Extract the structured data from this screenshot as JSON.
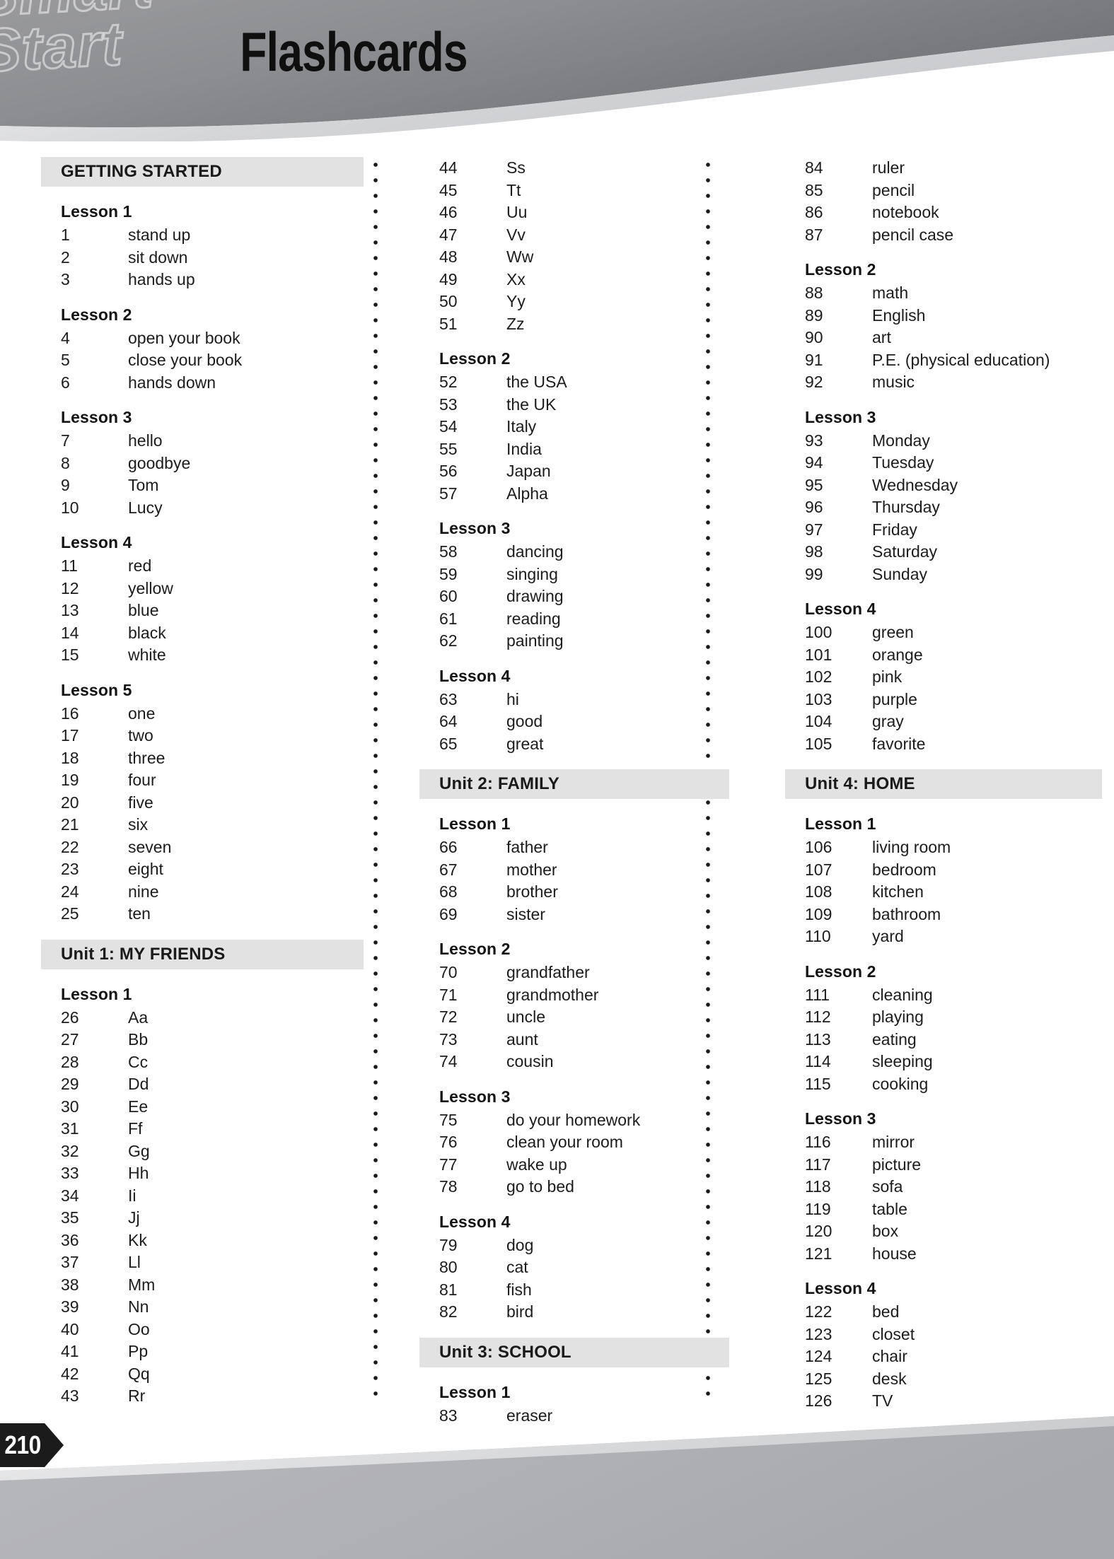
{
  "page": {
    "title": "Flashcards",
    "watermark_line1": "Smart",
    "watermark_line2": "Start",
    "page_number": "210"
  },
  "columns": [
    {
      "id": "column-1",
      "sections": [
        {
          "header": "GETTING STARTED",
          "lessons": [
            {
              "title": "Lesson 1",
              "items": [
                {
                  "num": "1",
                  "term": "stand up"
                },
                {
                  "num": "2",
                  "term": "sit down"
                },
                {
                  "num": "3",
                  "term": "hands up"
                }
              ]
            },
            {
              "title": "Lesson 2",
              "items": [
                {
                  "num": "4",
                  "term": "open your book"
                },
                {
                  "num": "5",
                  "term": "close your book"
                },
                {
                  "num": "6",
                  "term": "hands down"
                }
              ]
            },
            {
              "title": "Lesson 3",
              "items": [
                {
                  "num": "7",
                  "term": "hello"
                },
                {
                  "num": "8",
                  "term": "goodbye"
                },
                {
                  "num": "9",
                  "term": "Tom"
                },
                {
                  "num": "10",
                  "term": "Lucy"
                }
              ]
            },
            {
              "title": "Lesson 4",
              "items": [
                {
                  "num": "11",
                  "term": "red"
                },
                {
                  "num": "12",
                  "term": "yellow"
                },
                {
                  "num": "13",
                  "term": "blue"
                },
                {
                  "num": "14",
                  "term": "black"
                },
                {
                  "num": "15",
                  "term": "white"
                }
              ]
            },
            {
              "title": "Lesson 5",
              "items": [
                {
                  "num": "16",
                  "term": "one"
                },
                {
                  "num": "17",
                  "term": "two"
                },
                {
                  "num": "18",
                  "term": "three"
                },
                {
                  "num": "19",
                  "term": "four"
                },
                {
                  "num": "20",
                  "term": "five"
                },
                {
                  "num": "21",
                  "term": "six"
                },
                {
                  "num": "22",
                  "term": "seven"
                },
                {
                  "num": "23",
                  "term": "eight"
                },
                {
                  "num": "24",
                  "term": "nine"
                },
                {
                  "num": "25",
                  "term": "ten"
                }
              ]
            }
          ]
        },
        {
          "header": "Unit 1: MY FRIENDS",
          "lessons": [
            {
              "title": "Lesson 1",
              "items": [
                {
                  "num": "26",
                  "term": "Aa"
                },
                {
                  "num": "27",
                  "term": "Bb"
                },
                {
                  "num": "28",
                  "term": "Cc"
                },
                {
                  "num": "29",
                  "term": "Dd"
                },
                {
                  "num": "30",
                  "term": "Ee"
                },
                {
                  "num": "31",
                  "term": "Ff"
                },
                {
                  "num": "32",
                  "term": "Gg"
                },
                {
                  "num": "33",
                  "term": "Hh"
                },
                {
                  "num": "34",
                  "term": "Ii"
                },
                {
                  "num": "35",
                  "term": "Jj"
                },
                {
                  "num": "36",
                  "term": "Kk"
                },
                {
                  "num": "37",
                  "term": "Ll"
                },
                {
                  "num": "38",
                  "term": "Mm"
                },
                {
                  "num": "39",
                  "term": "Nn"
                },
                {
                  "num": "40",
                  "term": "Oo"
                },
                {
                  "num": "41",
                  "term": "Pp"
                },
                {
                  "num": "42",
                  "term": "Qq"
                },
                {
                  "num": "43",
                  "term": "Rr"
                }
              ]
            }
          ]
        }
      ]
    },
    {
      "id": "column-2",
      "sections": [
        {
          "header": null,
          "lessons": [
            {
              "title": null,
              "items": [
                {
                  "num": "44",
                  "term": "Ss"
                },
                {
                  "num": "45",
                  "term": "Tt"
                },
                {
                  "num": "46",
                  "term": "Uu"
                },
                {
                  "num": "47",
                  "term": "Vv"
                },
                {
                  "num": "48",
                  "term": "Ww"
                },
                {
                  "num": "49",
                  "term": "Xx"
                },
                {
                  "num": "50",
                  "term": "Yy"
                },
                {
                  "num": "51",
                  "term": "Zz"
                }
              ]
            },
            {
              "title": "Lesson 2",
              "items": [
                {
                  "num": "52",
                  "term": "the USA"
                },
                {
                  "num": "53",
                  "term": "the UK"
                },
                {
                  "num": "54",
                  "term": "Italy"
                },
                {
                  "num": "55",
                  "term": "India"
                },
                {
                  "num": "56",
                  "term": "Japan"
                },
                {
                  "num": "57",
                  "term": "Alpha"
                }
              ]
            },
            {
              "title": "Lesson 3",
              "items": [
                {
                  "num": "58",
                  "term": "dancing"
                },
                {
                  "num": "59",
                  "term": "singing"
                },
                {
                  "num": "60",
                  "term": "drawing"
                },
                {
                  "num": "61",
                  "term": "reading"
                },
                {
                  "num": "62",
                  "term": "painting"
                }
              ]
            },
            {
              "title": "Lesson 4",
              "items": [
                {
                  "num": "63",
                  "term": "hi"
                },
                {
                  "num": "64",
                  "term": "good"
                },
                {
                  "num": "65",
                  "term": "great"
                }
              ]
            }
          ]
        },
        {
          "header": "Unit 2: FAMILY",
          "lessons": [
            {
              "title": "Lesson 1",
              "items": [
                {
                  "num": "66",
                  "term": "father"
                },
                {
                  "num": "67",
                  "term": "mother"
                },
                {
                  "num": "68",
                  "term": "brother"
                },
                {
                  "num": "69",
                  "term": "sister"
                }
              ]
            },
            {
              "title": "Lesson 2",
              "items": [
                {
                  "num": "70",
                  "term": "grandfather"
                },
                {
                  "num": "71",
                  "term": "grandmother"
                },
                {
                  "num": "72",
                  "term": "uncle"
                },
                {
                  "num": "73",
                  "term": "aunt"
                },
                {
                  "num": "74",
                  "term": "cousin"
                }
              ]
            },
            {
              "title": "Lesson 3",
              "items": [
                {
                  "num": "75",
                  "term": "do your homework"
                },
                {
                  "num": "76",
                  "term": "clean your room"
                },
                {
                  "num": "77",
                  "term": "wake up"
                },
                {
                  "num": "78",
                  "term": "go to bed"
                }
              ]
            },
            {
              "title": "Lesson 4",
              "items": [
                {
                  "num": "79",
                  "term": "dog"
                },
                {
                  "num": "80",
                  "term": "cat"
                },
                {
                  "num": "81",
                  "term": "fish"
                },
                {
                  "num": "82",
                  "term": "bird"
                }
              ]
            }
          ]
        },
        {
          "header": "Unit 3: SCHOOL",
          "lessons": [
            {
              "title": "Lesson 1",
              "items": [
                {
                  "num": "83",
                  "term": "eraser"
                }
              ]
            }
          ]
        }
      ]
    },
    {
      "id": "column-3",
      "sections": [
        {
          "header": null,
          "lessons": [
            {
              "title": null,
              "items": [
                {
                  "num": "84",
                  "term": "ruler"
                },
                {
                  "num": "85",
                  "term": "pencil"
                },
                {
                  "num": "86",
                  "term": "notebook"
                },
                {
                  "num": "87",
                  "term": "pencil case"
                }
              ]
            },
            {
              "title": "Lesson 2",
              "items": [
                {
                  "num": "88",
                  "term": "math"
                },
                {
                  "num": "89",
                  "term": "English"
                },
                {
                  "num": "90",
                  "term": "art"
                },
                {
                  "num": "91",
                  "term": "P.E. (physical education)"
                },
                {
                  "num": "92",
                  "term": "music"
                }
              ]
            },
            {
              "title": "Lesson 3",
              "items": [
                {
                  "num": "93",
                  "term": "Monday"
                },
                {
                  "num": "94",
                  "term": "Tuesday"
                },
                {
                  "num": "95",
                  "term": "Wednesday"
                },
                {
                  "num": "96",
                  "term": "Thursday"
                },
                {
                  "num": "97",
                  "term": "Friday"
                },
                {
                  "num": "98",
                  "term": "Saturday"
                },
                {
                  "num": "99",
                  "term": "Sunday"
                }
              ]
            },
            {
              "title": "Lesson 4",
              "items": [
                {
                  "num": "100",
                  "term": "green"
                },
                {
                  "num": "101",
                  "term": "orange"
                },
                {
                  "num": "102",
                  "term": "pink"
                },
                {
                  "num": "103",
                  "term": "purple"
                },
                {
                  "num": "104",
                  "term": "gray"
                },
                {
                  "num": "105",
                  "term": "favorite"
                }
              ]
            }
          ]
        },
        {
          "header": "Unit 4: HOME",
          "lessons": [
            {
              "title": "Lesson 1",
              "items": [
                {
                  "num": "106",
                  "term": "living room"
                },
                {
                  "num": "107",
                  "term": "bedroom"
                },
                {
                  "num": "108",
                  "term": "kitchen"
                },
                {
                  "num": "109",
                  "term": "bathroom"
                },
                {
                  "num": "110",
                  "term": "yard"
                }
              ]
            },
            {
              "title": "Lesson 2",
              "items": [
                {
                  "num": "111",
                  "term": "cleaning"
                },
                {
                  "num": "112",
                  "term": "playing"
                },
                {
                  "num": "113",
                  "term": "eating"
                },
                {
                  "num": "114",
                  "term": "sleeping"
                },
                {
                  "num": "115",
                  "term": "cooking"
                }
              ]
            },
            {
              "title": "Lesson 3",
              "items": [
                {
                  "num": "116",
                  "term": "mirror"
                },
                {
                  "num": "117",
                  "term": "picture"
                },
                {
                  "num": "118",
                  "term": "sofa"
                },
                {
                  "num": "119",
                  "term": "table"
                },
                {
                  "num": "120",
                  "term": "box"
                },
                {
                  "num": "121",
                  "term": "house"
                }
              ]
            },
            {
              "title": "Lesson 4",
              "items": [
                {
                  "num": "122",
                  "term": "bed"
                },
                {
                  "num": "123",
                  "term": "closet"
                },
                {
                  "num": "124",
                  "term": "chair"
                },
                {
                  "num": "125",
                  "term": "desk"
                },
                {
                  "num": "126",
                  "term": "TV"
                }
              ]
            }
          ]
        }
      ]
    }
  ]
}
